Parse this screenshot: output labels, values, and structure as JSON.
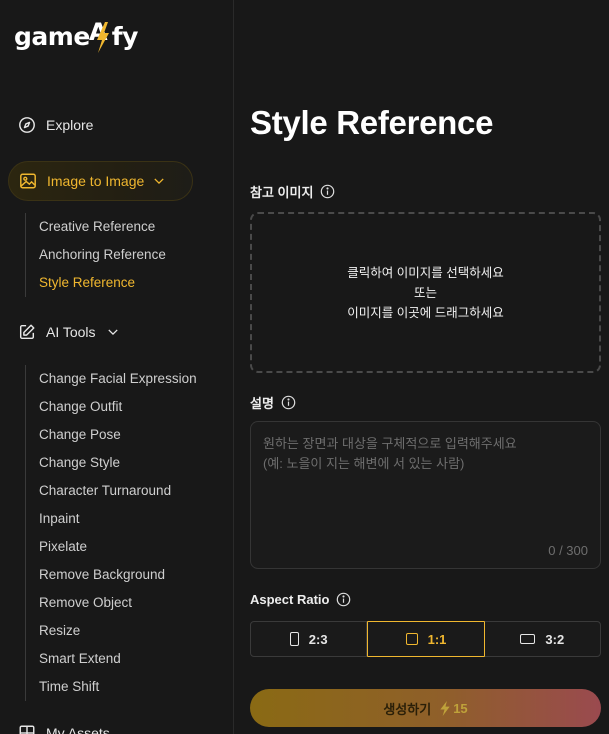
{
  "brand": {
    "logo_prefix": "game",
    "logo_suffix": "fy",
    "logo_mid": "AI"
  },
  "sidebar": {
    "explore": {
      "label": "Explore",
      "icon": "compass-icon"
    },
    "image_to_image": {
      "label": "Image to Image",
      "icon": "image-icon",
      "items": [
        {
          "label": "Creative Reference",
          "active": false
        },
        {
          "label": "Anchoring Reference",
          "active": false
        },
        {
          "label": "Style Reference",
          "active": true
        }
      ]
    },
    "ai_tools": {
      "label": "AI Tools",
      "icon": "edit-icon",
      "items": [
        {
          "label": "Change Facial Expression"
        },
        {
          "label": "Change Outfit"
        },
        {
          "label": "Change Pose"
        },
        {
          "label": "Change Style"
        },
        {
          "label": "Character Turnaround"
        },
        {
          "label": "Inpaint"
        },
        {
          "label": "Pixelate"
        },
        {
          "label": "Remove Background"
        },
        {
          "label": "Remove Object"
        },
        {
          "label": "Resize"
        },
        {
          "label": "Smart Extend"
        },
        {
          "label": "Time Shift"
        }
      ]
    },
    "my_assets": {
      "label": "My Assets",
      "icon": "grid-icon"
    }
  },
  "main": {
    "title": "Style Reference",
    "reference": {
      "label": "참고 이미지",
      "line1": "클릭하여 이미지를 선택하세요",
      "line2": "또는",
      "line3": "이미지를 이곳에 드래그하세요"
    },
    "description": {
      "label": "설명",
      "placeholder": "원하는 장면과 대상을 구체적으로 입력해주세요\n(예: 노을이 지는 해변에 서 있는 사람)",
      "value": "",
      "counter": "0 / 300"
    },
    "aspect_ratio": {
      "label": "Aspect Ratio",
      "options": [
        {
          "label": "2:3",
          "selected": false
        },
        {
          "label": "1:1",
          "selected": true
        },
        {
          "label": "3:2",
          "selected": false
        }
      ]
    },
    "generate": {
      "label": "생성하기",
      "cost": "15"
    }
  },
  "colors": {
    "accent": "#f0b72f",
    "background": "#181818",
    "text": "#e8e8e8"
  }
}
